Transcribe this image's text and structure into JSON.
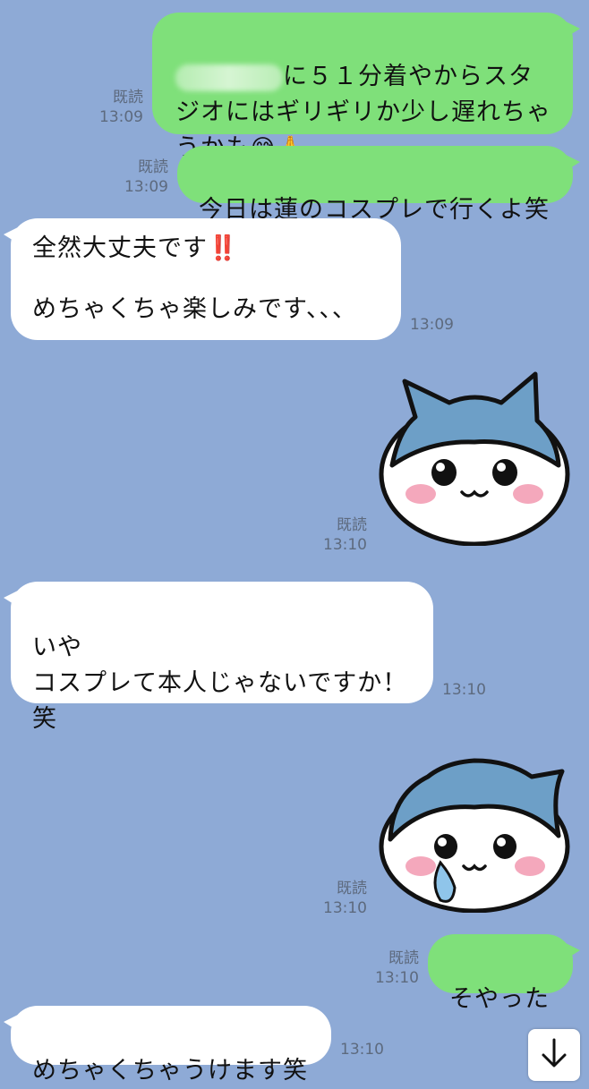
{
  "messages": [
    {
      "kind": "text",
      "dir": "out",
      "text_visible": "に５１分着やからスタジオにはギリギリか少し遅れちゃうかも",
      "read": "既読",
      "time": "13:09",
      "emoji": [
        "grinning-sweat",
        "folded-hands"
      ]
    },
    {
      "kind": "text",
      "dir": "out",
      "text": "今日は蓮のコスプレで行くよ笑",
      "read": "既読",
      "time": "13:09"
    },
    {
      "kind": "text",
      "dir": "in",
      "line1": "全然大丈夫です",
      "line1_mark": "‼️",
      "line2": "めちゃくちゃ楽しみです、、、",
      "time": "13:09"
    },
    {
      "kind": "sticker",
      "dir": "out",
      "sticker": "smiling-cat-cap-sticker",
      "read": "既読",
      "time": "13:10"
    },
    {
      "kind": "text",
      "dir": "in",
      "text": "いや\nコスプレて本人じゃないですか！\n笑",
      "time": "13:10"
    },
    {
      "kind": "sticker",
      "dir": "out",
      "sticker": "crying-cat-cap-sticker",
      "read": "既読",
      "time": "13:10"
    },
    {
      "kind": "text",
      "dir": "out",
      "text": "そやった",
      "read": "既読",
      "time": "13:10"
    },
    {
      "kind": "text",
      "dir": "in",
      "text": "めちゃくちゃうけます笑",
      "time": "13:10"
    }
  ],
  "scroll_button_icon": "arrow-down-icon",
  "colors": {
    "background": "#8eaad6",
    "outgoing": "#7fe07a",
    "incoming": "#ffffff",
    "meta": "#5d6a7e"
  }
}
